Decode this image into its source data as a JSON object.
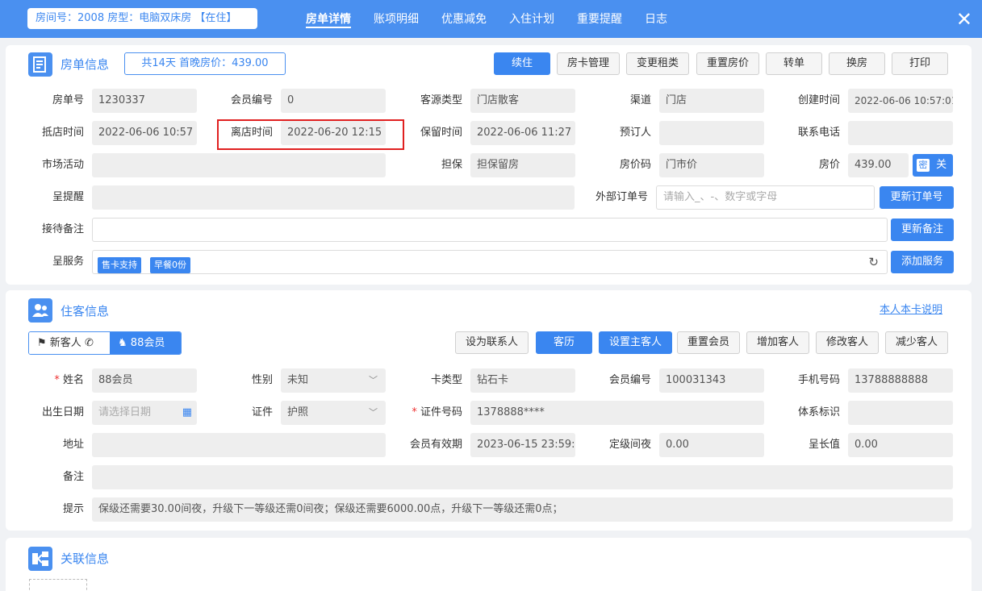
{
  "header": {
    "room_badge": "房间号：2008 房型：电脑双床房 【在住】",
    "tabs": [
      "房单详情",
      "账项明细",
      "优惠减免",
      "入住计划",
      "重要提醒",
      "日志"
    ],
    "close": "✕"
  },
  "order": {
    "title": "房单信息",
    "summary": "共14天   首晚房价：439.00",
    "buttons": [
      "续住",
      "房卡管理",
      "变更租类",
      "重置房价",
      "转单",
      "换房",
      "打印"
    ],
    "labels": {
      "order_no": "房单号",
      "member_no": "会员编号",
      "source": "客源类型",
      "channel": "渠道",
      "created": "创建时间",
      "arrive": "抵店时间",
      "depart": "离店时间",
      "hold": "保留时间",
      "booker": "预订人",
      "phone": "联系电话",
      "activity": "市场活动",
      "guarantee": "担保",
      "rate_code": "房价码",
      "price": "房价",
      "remind": "呈提醒",
      "ext_order": "外部订单号",
      "reception_note": "接待备注",
      "services": "呈服务"
    },
    "values": {
      "order_no": "1230337",
      "member_no": "0",
      "source": "门店散客",
      "channel": "门店",
      "created": "2022-06-06 10:57:01",
      "arrive": "2022-06-06 10:57",
      "depart": "2022-06-20 12:15",
      "hold": "2022-06-06 11:27",
      "booker": "",
      "phone": "",
      "activity": "",
      "guarantee": "担保留房",
      "rate_code": "门市价",
      "price": "439.00",
      "remind": "",
      "ext_order_placeholder": "请输入_、-、数字或字母",
      "reception_note": ""
    },
    "price_secret": "密",
    "price_close": "关",
    "btn_update_order": "更新订单号",
    "btn_update_note": "更新备注",
    "btn_add_service": "添加服务",
    "service_tags": [
      "售卡支持",
      "早餐0份"
    ]
  },
  "guest": {
    "title": "住客信息",
    "help_link": "本人本卡说明",
    "guest_tabs": [
      "新客人",
      "88会员"
    ],
    "buttons": [
      "设为联系人",
      "客历",
      "设置主客人",
      "重置会员",
      "增加客人",
      "修改客人",
      "减少客人"
    ],
    "labels": {
      "name": "姓名",
      "gender": "性别",
      "card_type": "卡类型",
      "member_no": "会员编号",
      "mobile": "手机号码",
      "birthday": "出生日期",
      "id_type": "证件",
      "id_no": "证件号码",
      "system_id": "体系标识",
      "address": "地址",
      "expire": "会员有效期",
      "nights": "定级间夜",
      "growth": "呈长值",
      "remark": "备注",
      "hint": "提示"
    },
    "values": {
      "name": "88会员",
      "gender": "未知",
      "card_type": "钻石卡",
      "member_no": "100031343",
      "mobile": "13788888888",
      "birthday_placeholder": "请选择日期",
      "id_type": "护照",
      "id_no": "1378888****",
      "system_id": "",
      "address": "",
      "expire": "2023-06-15 23:59:",
      "nights": "0.00",
      "growth": "0.00",
      "remark": "",
      "hint": "保级还需要30.00间夜，升级下一等级还需0间夜；保级还需要6000.00点，升级下一等级还需0点；"
    }
  },
  "related": {
    "title": "关联信息"
  },
  "colors": {
    "primary": "#3a86f0",
    "header": "#4a90f0",
    "highlight": "#e02020"
  }
}
